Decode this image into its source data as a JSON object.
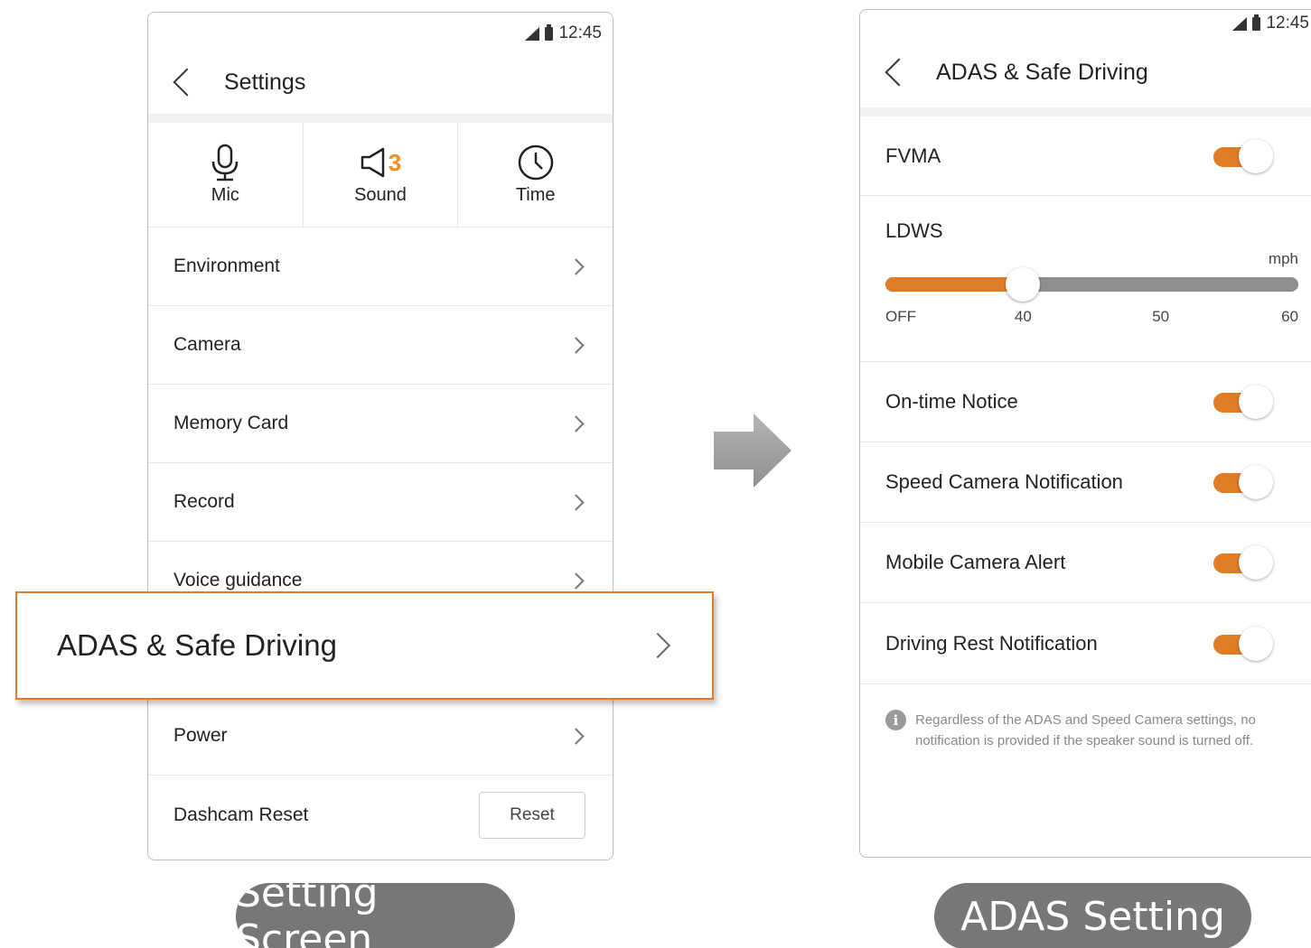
{
  "left_screen": {
    "status_time": "12:45",
    "title": "Settings",
    "quick": [
      {
        "label": "Mic",
        "icon": "mic-icon"
      },
      {
        "label": "Sound",
        "icon": "speaker-icon",
        "badge": "3"
      },
      {
        "label": "Time",
        "icon": "clock-icon"
      }
    ],
    "menu": [
      {
        "label": "Environment"
      },
      {
        "label": "Camera"
      },
      {
        "label": "Memory Card"
      },
      {
        "label": "Record"
      },
      {
        "label": "Voice guidance"
      },
      {
        "label": "Power"
      },
      {
        "label": "Dashcam Reset"
      }
    ],
    "reset_button": "Reset",
    "callout_label": "ADAS & Safe Driving"
  },
  "right_screen": {
    "status_time": "12:45",
    "title": "ADAS & Safe Driving",
    "fvma": {
      "label": "FVMA",
      "on": true
    },
    "ldws": {
      "label": "LDWS",
      "unit": "mph",
      "ticks": [
        "OFF",
        "40",
        "50",
        "60"
      ],
      "value": "40"
    },
    "toggles": [
      {
        "label": "On-time Notice",
        "on": true
      },
      {
        "label": "Speed Camera Notification",
        "on": true
      },
      {
        "label": "Mobile Camera Alert",
        "on": true
      },
      {
        "label": "Driving Rest Notification",
        "on": true
      }
    ],
    "note": "Regardless of the ADAS and Speed Camera settings, no notification is provided if the speaker sound is turned off."
  },
  "captions": {
    "left": "Setting Screen",
    "right": "ADAS Setting"
  },
  "colors": {
    "accent": "#e07b26",
    "caption_bg": "#777777",
    "slider_track": "#8e8e8e"
  }
}
